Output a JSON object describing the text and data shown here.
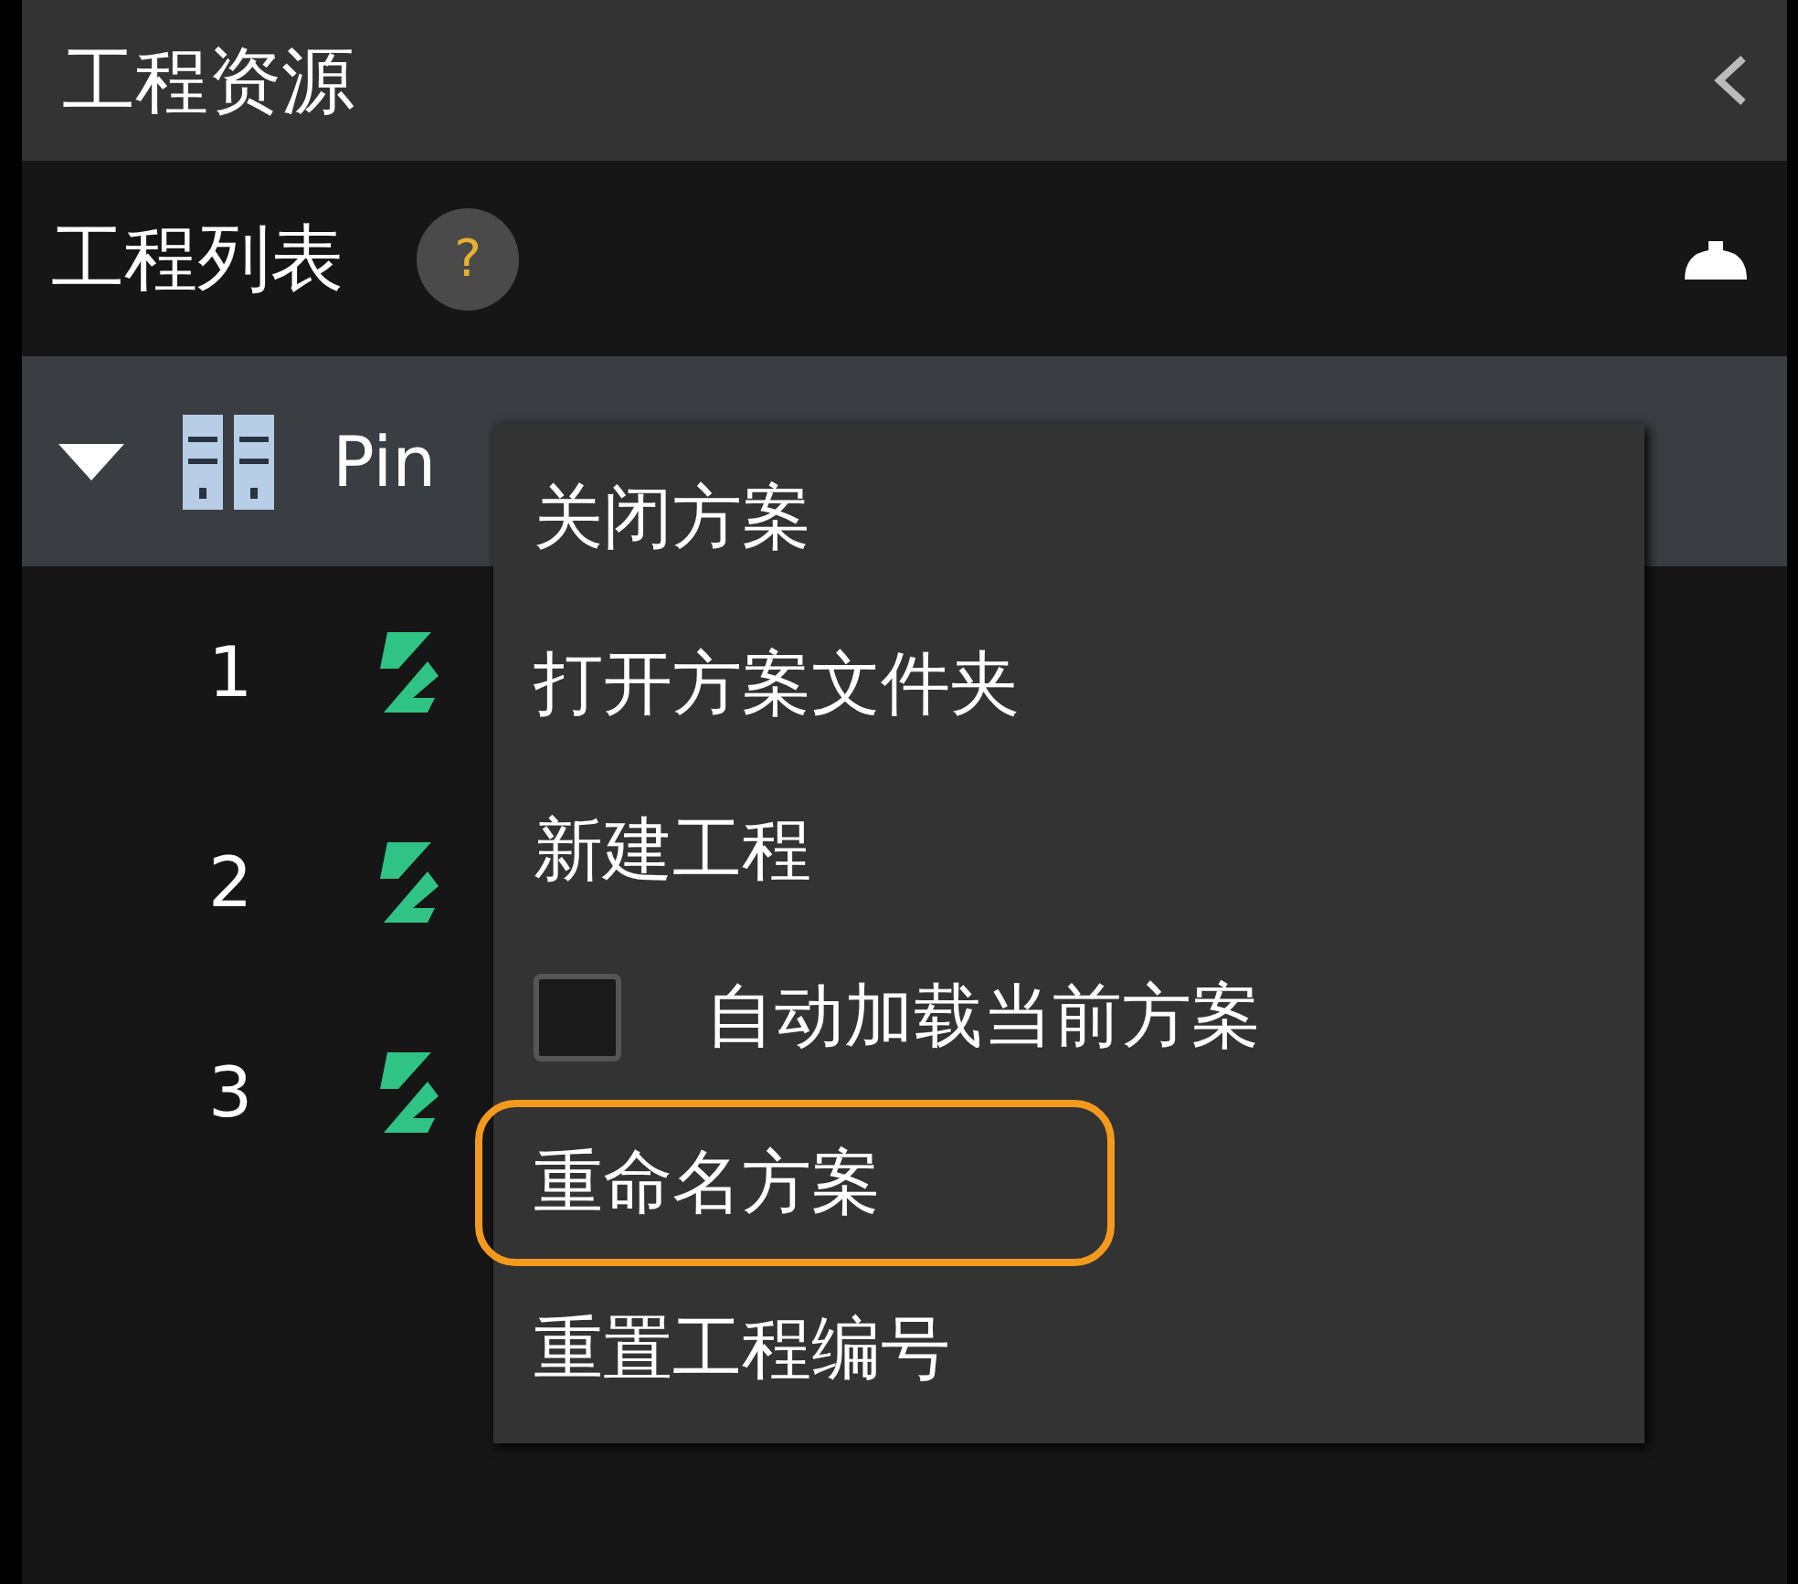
{
  "panel": {
    "title": "工程资源"
  },
  "section": {
    "title": "工程列表",
    "help": "?"
  },
  "tree": {
    "label": "Pin",
    "expanded": true,
    "children": [
      {
        "number": "1"
      },
      {
        "number": "2"
      },
      {
        "number": "3"
      }
    ]
  },
  "context_menu": {
    "items": [
      {
        "kind": "action",
        "label": "关闭方案",
        "outlined": false
      },
      {
        "kind": "action",
        "label": "打开方案文件夹",
        "outlined": false
      },
      {
        "kind": "action",
        "label": "新建工程",
        "outlined": false
      },
      {
        "kind": "checkbox",
        "label": "自动加载当前方案",
        "checked": false,
        "outlined": false
      },
      {
        "kind": "action",
        "label": "重命名方案",
        "outlined": true
      },
      {
        "kind": "action",
        "label": "重置工程编号",
        "outlined": false
      }
    ]
  }
}
